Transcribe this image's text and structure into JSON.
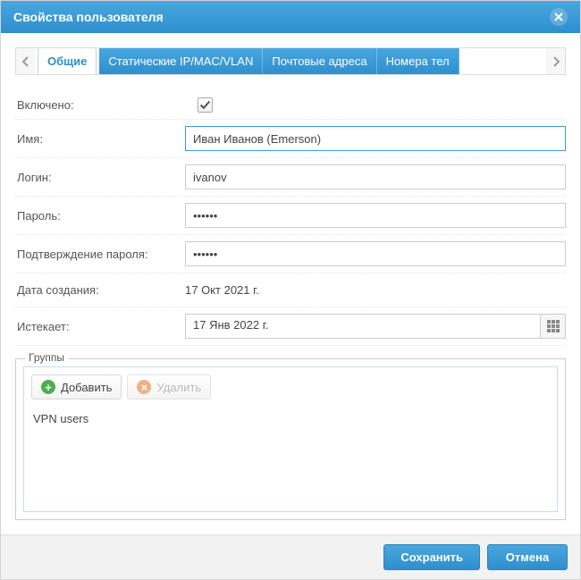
{
  "dialog": {
    "title": "Свойства пользователя"
  },
  "tabs": [
    {
      "label": "Общие",
      "active": true
    },
    {
      "label": "Статические IP/MAC/VLAN",
      "active": false
    },
    {
      "label": "Почтовые адреса",
      "active": false
    },
    {
      "label": "Номера тел",
      "active": false
    }
  ],
  "form": {
    "enabled": {
      "label": "Включено:",
      "checked": true
    },
    "name": {
      "label": "Имя:",
      "value": "Иван Иванов (Emerson)"
    },
    "login": {
      "label": "Логин:",
      "value": "ivanov"
    },
    "password": {
      "label": "Пароль:",
      "value": "••••••"
    },
    "password_confirm": {
      "label": "Подтверждение пароля:",
      "value": "••••••"
    },
    "created": {
      "label": "Дата создания:",
      "value": "17 Окт 2021 г."
    },
    "expires": {
      "label": "Истекает:",
      "value": "17 Янв 2022 г."
    }
  },
  "groups": {
    "legend": "Группы",
    "add_label": "Добавить",
    "delete_label": "Удалить",
    "items": [
      "VPN users"
    ]
  },
  "footer": {
    "save": "Сохранить",
    "cancel": "Отмена"
  }
}
